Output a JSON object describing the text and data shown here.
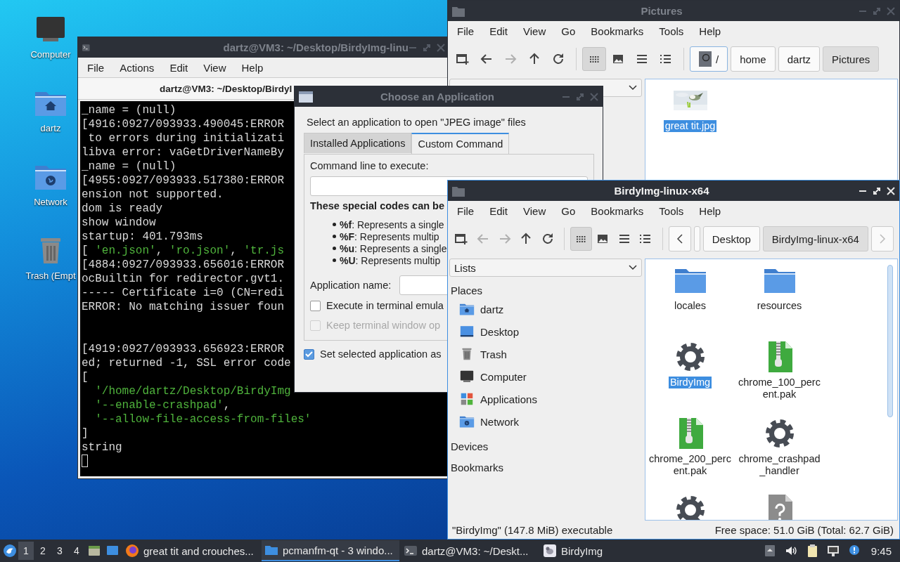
{
  "desktop_icons": [
    {
      "label": "Computer",
      "kind": "computer"
    },
    {
      "label": "dartz",
      "kind": "home"
    },
    {
      "label": "Network",
      "kind": "network"
    },
    {
      "label": "Trash (Empt",
      "kind": "trash"
    }
  ],
  "terminal": {
    "title": "dartz@VM3: ~/Desktop/BirdyImg-linu",
    "active": false,
    "menu": [
      "File",
      "Actions",
      "Edit",
      "View",
      "Help"
    ],
    "tab_title": "dartz@VM3: ~/Desktop/BirdyI",
    "cursor": true,
    "lines": [
      {
        "segments": [
          {
            "text": "_name = (null)",
            "kind": "plain"
          }
        ]
      },
      {
        "segments": [
          {
            "text": "[4916:0927/093933.490045:ERROR",
            "kind": "plain"
          }
        ]
      },
      {
        "segments": [
          {
            "text": " to errors during initializati",
            "kind": "plain"
          }
        ]
      },
      {
        "segments": [
          {
            "text": "libva error: vaGetDriverNameBy",
            "kind": "plain"
          }
        ]
      },
      {
        "segments": [
          {
            "text": "_name = (null)",
            "kind": "plain"
          }
        ]
      },
      {
        "segments": [
          {
            "text": "[4955:0927/093933.517380:ERROR",
            "kind": "plain"
          }
        ]
      },
      {
        "segments": [
          {
            "text": "ension not supported.",
            "kind": "plain"
          }
        ]
      },
      {
        "segments": [
          {
            "text": "dom is ready",
            "kind": "plain"
          }
        ]
      },
      {
        "segments": [
          {
            "text": "show window",
            "kind": "plain"
          }
        ]
      },
      {
        "segments": [
          {
            "text": "startup: 401.793ms",
            "kind": "plain"
          }
        ]
      },
      {
        "segments": [
          {
            "text": "[ ",
            "kind": "plain"
          },
          {
            "text": "'en.json'",
            "kind": "string"
          },
          {
            "text": ", ",
            "kind": "plain"
          },
          {
            "text": "'ro.json'",
            "kind": "string"
          },
          {
            "text": ", ",
            "kind": "plain"
          },
          {
            "text": "'tr.js",
            "kind": "string"
          }
        ]
      },
      {
        "segments": [
          {
            "text": "[4884:0927/093933.656016:ERROR",
            "kind": "plain"
          }
        ]
      },
      {
        "segments": [
          {
            "text": "ocBuiltin for redirector.gvt1.",
            "kind": "plain"
          }
        ]
      },
      {
        "segments": [
          {
            "text": "----- Certificate i=0 (CN=redi",
            "kind": "plain"
          }
        ]
      },
      {
        "segments": [
          {
            "text": "ERROR: No matching issuer foun",
            "kind": "plain"
          }
        ]
      },
      {
        "kind": "blank"
      },
      {
        "kind": "blank"
      },
      {
        "segments": [
          {
            "text": "[4919:0927/093933.656923:ERROR",
            "kind": "plain"
          }
        ]
      },
      {
        "segments": [
          {
            "text": "ed; returned -1, SSL error code",
            "kind": "plain"
          }
        ]
      },
      {
        "segments": [
          {
            "text": "[",
            "kind": "plain"
          }
        ]
      },
      {
        "segments": [
          {
            "text": "  '/home/dartz/Desktop/BirdyImg",
            "kind": "string"
          }
        ]
      },
      {
        "segments": [
          {
            "text": "  '--enable-crashpad'",
            "kind": "string"
          },
          {
            "text": ",",
            "kind": "plain"
          }
        ]
      },
      {
        "segments": [
          {
            "text": "  '--allow-file-access-from-files'",
            "kind": "string"
          }
        ]
      },
      {
        "segments": [
          {
            "text": "]",
            "kind": "plain"
          }
        ]
      },
      {
        "segments": [
          {
            "text": "string",
            "kind": "plain"
          }
        ]
      }
    ]
  },
  "pictures_window": {
    "title": "Pictures",
    "active": false,
    "menu": [
      "File",
      "Edit",
      "View",
      "Go",
      "Bookmarks",
      "Tools",
      "Help"
    ],
    "nav": [
      {
        "kind": "new-tab",
        "disabled": false
      },
      {
        "kind": "back",
        "disabled": false
      },
      {
        "kind": "forward",
        "disabled": true
      },
      {
        "kind": "up",
        "disabled": false
      },
      {
        "kind": "reload",
        "disabled": false
      }
    ],
    "view_modes": [
      {
        "kind": "icons",
        "selected": true
      },
      {
        "kind": "thumbnails",
        "selected": false
      },
      {
        "kind": "compact",
        "selected": false
      },
      {
        "kind": "details",
        "selected": false
      }
    ],
    "path": [
      {
        "kind": "root",
        "label": "/",
        "selected": false
      },
      {
        "label": "home",
        "selected": false
      },
      {
        "label": "dartz",
        "selected": false
      },
      {
        "label": "Pictures",
        "selected": true
      }
    ],
    "files": [
      {
        "kind": "picture",
        "label": "great tit.jpg",
        "selected": true
      }
    ]
  },
  "dialog": {
    "title": "Choose an Application",
    "active": false,
    "prompt": "Select an application to open \"JPEG image\" files",
    "tabs": [
      {
        "label": "Installed Applications",
        "selected": false
      },
      {
        "label": "Custom Command",
        "selected": true
      }
    ],
    "command_label": "Command line to execute:",
    "codes_heading": "These special codes can be",
    "codes": [
      "**%f**: Represents a single",
      "**%F**: Represents multip",
      "**%u**: Represents a single",
      "**%U**: Represents multip"
    ],
    "app_name_label": "Application name:",
    "options": [
      {
        "label": "Execute in terminal emula",
        "checked": false,
        "disabled": false
      },
      {
        "label": "Keep terminal window op",
        "checked": false,
        "disabled": true
      }
    ],
    "default_option": {
      "label": "Set selected application as",
      "checked": true
    }
  },
  "birdy_window": {
    "title": "BirdyImg-linux-x64",
    "active": true,
    "menu": [
      "File",
      "Edit",
      "View",
      "Go",
      "Bookmarks",
      "Tools",
      "Help"
    ],
    "nav": [
      {
        "kind": "new-tab",
        "disabled": false
      },
      {
        "kind": "back",
        "disabled": true
      },
      {
        "kind": "forward",
        "disabled": true
      },
      {
        "kind": "up",
        "disabled": false
      },
      {
        "kind": "reload",
        "disabled": false
      }
    ],
    "view_modes": [
      {
        "kind": "icons",
        "selected": true
      },
      {
        "kind": "thumbnails",
        "selected": false
      },
      {
        "kind": "compact",
        "selected": false
      },
      {
        "kind": "details",
        "selected": false
      }
    ],
    "path_scroll": {
      "left_disabled": false,
      "right_disabled": true
    },
    "path": [
      {
        "label": "Desktop",
        "selected": false
      },
      {
        "label": "BirdyImg-linux-x64",
        "selected": true
      }
    ],
    "side_panel": {
      "dropdown": "Lists",
      "sections": [
        {
          "title": "Places",
          "items": [
            {
              "label": "dartz",
              "kind": "home"
            },
            {
              "label": "Desktop",
              "kind": "desktop"
            },
            {
              "label": "Trash",
              "kind": "trash"
            },
            {
              "label": "Computer",
              "kind": "computer"
            },
            {
              "label": "Applications",
              "kind": "apps"
            },
            {
              "label": "Network",
              "kind": "network"
            }
          ]
        },
        {
          "title": "Devices"
        },
        {
          "title": "Bookmarks"
        }
      ]
    },
    "files": [
      {
        "kind": "folder",
        "label": "locales",
        "selected": false
      },
      {
        "kind": "folder",
        "label": "resources",
        "selected": false
      },
      {
        "kind": "executable",
        "label": "BirdyImg",
        "selected": true
      },
      {
        "kind": "archive",
        "label": "chrome_100_percent.pak",
        "selected": false
      },
      {
        "kind": "archive",
        "label": "chrome_200_percent.pak",
        "selected": false
      },
      {
        "kind": "executable",
        "label": "chrome_crashpad_handler",
        "selected": false
      },
      {
        "kind": "executable",
        "selected": false
      },
      {
        "kind": "unknown",
        "selected": false
      }
    ],
    "status": {
      "left": "\"BirdyImg\" (147.8 MiB) executable",
      "right": "Free space: 51.0 GiB (Total: 62.7 GiB)"
    }
  },
  "taskbar": {
    "workspaces": [
      {
        "label": "1",
        "selected": true
      },
      {
        "label": "2",
        "selected": false
      },
      {
        "label": "3",
        "selected": false
      },
      {
        "label": "4",
        "selected": false
      }
    ],
    "launchers": [
      {
        "kind": "file-manager"
      },
      {
        "kind": "show-desktop"
      }
    ],
    "tasks": [
      {
        "kind": "browser",
        "label": "great tit and crouches...",
        "selected": false
      },
      {
        "kind": "file-manager",
        "label": "pcmanfm-qt - 3 windo...",
        "selected": true
      },
      {
        "kind": "terminal",
        "label": "dartz@VM3: ~/Deskt...",
        "selected": false
      },
      {
        "kind": "image-app",
        "label": "BirdyImg",
        "selected": false
      }
    ],
    "tray": [
      {
        "kind": "up-arrow"
      },
      {
        "kind": "volume"
      },
      {
        "kind": "clipboard"
      },
      {
        "kind": "network"
      },
      {
        "kind": "notification"
      }
    ],
    "clock": "9:45"
  }
}
